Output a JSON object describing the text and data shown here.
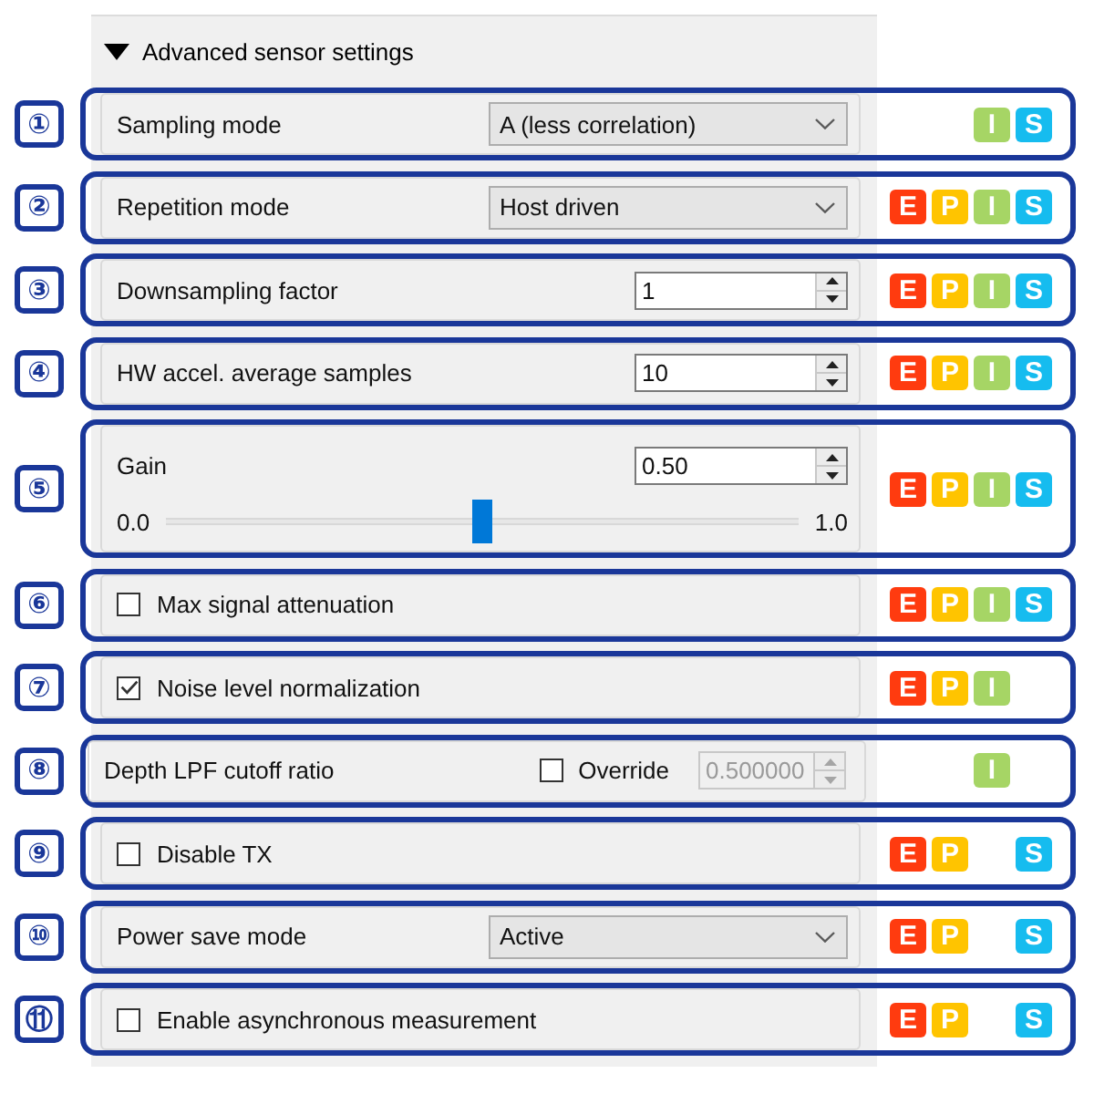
{
  "section": {
    "title": "Advanced sensor settings",
    "expanded": true
  },
  "rows": [
    {
      "number": "①",
      "kind": "dropdown",
      "label": "Sampling mode",
      "value": "A (less correlation)",
      "tags": [
        {
          "kind": "i",
          "text": "I",
          "color": "#a6d565"
        },
        {
          "kind": "s",
          "text": "S",
          "color": "#16bcef"
        }
      ]
    },
    {
      "number": "②",
      "kind": "dropdown",
      "label": "Repetition mode",
      "value": "Host driven",
      "tags": [
        {
          "kind": "e",
          "text": "E",
          "color": "#ff3b0f"
        },
        {
          "kind": "p",
          "text": "P",
          "color": "#ffc400"
        },
        {
          "kind": "i",
          "text": "I",
          "color": "#a6d565"
        },
        {
          "kind": "s",
          "text": "S",
          "color": "#16bcef"
        }
      ]
    },
    {
      "number": "③",
      "kind": "spinbox",
      "label": "Downsampling factor",
      "value": "1",
      "tags": [
        {
          "kind": "e",
          "text": "E",
          "color": "#ff3b0f"
        },
        {
          "kind": "p",
          "text": "P",
          "color": "#ffc400"
        },
        {
          "kind": "i",
          "text": "I",
          "color": "#a6d565"
        },
        {
          "kind": "s",
          "text": "S",
          "color": "#16bcef"
        }
      ]
    },
    {
      "number": "④",
      "kind": "spinbox",
      "label": "HW accel. average samples",
      "value": "10",
      "tags": [
        {
          "kind": "e",
          "text": "E",
          "color": "#ff3b0f"
        },
        {
          "kind": "p",
          "text": "P",
          "color": "#ffc400"
        },
        {
          "kind": "i",
          "text": "I",
          "color": "#a6d565"
        },
        {
          "kind": "s",
          "text": "S",
          "color": "#16bcef"
        }
      ]
    },
    {
      "number": "⑤",
      "kind": "slider",
      "label": "Gain",
      "value": "0.50",
      "min": "0.0",
      "max": "1.0",
      "level": 0.5,
      "tags": [
        {
          "kind": "e",
          "text": "E",
          "color": "#ff3b0f"
        },
        {
          "kind": "p",
          "text": "P",
          "color": "#ffc400"
        },
        {
          "kind": "i",
          "text": "I",
          "color": "#a6d565"
        },
        {
          "kind": "s",
          "text": "S",
          "color": "#16bcef"
        }
      ]
    },
    {
      "number": "⑥",
      "kind": "checkbox",
      "label": "Max signal attenuation",
      "checked": false,
      "tags": [
        {
          "kind": "e",
          "text": "E",
          "color": "#ff3b0f"
        },
        {
          "kind": "p",
          "text": "P",
          "color": "#ffc400"
        },
        {
          "kind": "i",
          "text": "I",
          "color": "#a6d565"
        },
        {
          "kind": "s",
          "text": "S",
          "color": "#16bcef"
        }
      ]
    },
    {
      "number": "⑦",
      "kind": "checkbox",
      "label": "Noise level normalization",
      "checked": true,
      "tags": [
        {
          "kind": "e",
          "text": "E",
          "color": "#ff3b0f"
        },
        {
          "kind": "p",
          "text": "P",
          "color": "#ffc400"
        },
        {
          "kind": "i",
          "text": "I",
          "color": "#a6d565"
        }
      ]
    },
    {
      "number": "⑧",
      "kind": "override",
      "label": "Depth LPF cutoff ratio",
      "option": "Override",
      "checked": false,
      "field": {
        "value": "0.500000",
        "disabled": true
      },
      "tags": [
        {
          "kind": "i",
          "text": "I",
          "color": "#a6d565"
        }
      ]
    },
    {
      "number": "⑨",
      "kind": "checkbox",
      "label": "Disable TX",
      "checked": false,
      "tags": [
        {
          "kind": "e",
          "text": "E",
          "color": "#ff3b0f"
        },
        {
          "kind": "p",
          "text": "P",
          "color": "#ffc400"
        },
        {
          "kind": "s",
          "text": "S",
          "color": "#16bcef"
        }
      ]
    },
    {
      "number": "⑩",
      "kind": "dropdown",
      "label": "Power save mode",
      "value": "Active",
      "tags": [
        {
          "kind": "e",
          "text": "E",
          "color": "#ff3b0f"
        },
        {
          "kind": "p",
          "text": "P",
          "color": "#ffc400"
        },
        {
          "kind": "s",
          "text": "S",
          "color": "#16bcef"
        }
      ]
    },
    {
      "number": "⑪",
      "kind": "checkbox",
      "label": "Enable asynchronous measurement",
      "checked": false,
      "tags": [
        {
          "kind": "e",
          "text": "E",
          "color": "#ff3b0f"
        },
        {
          "kind": "p",
          "text": "P",
          "color": "#ffc400"
        },
        {
          "kind": "s",
          "text": "S",
          "color": "#16bcef"
        }
      ]
    }
  ]
}
